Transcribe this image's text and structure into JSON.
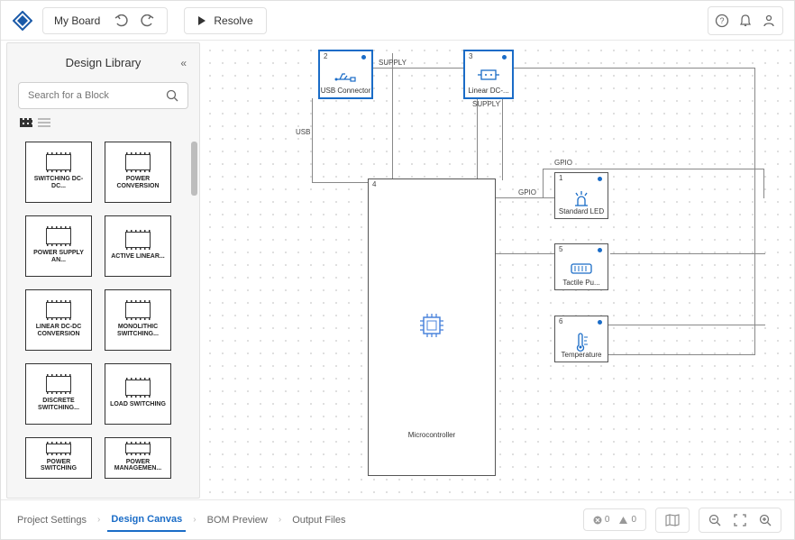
{
  "header": {
    "board_name": "My Board",
    "resolve_label": "Resolve"
  },
  "sidebar": {
    "title": "Design Library",
    "search_placeholder": "Search for a Block",
    "items": [
      {
        "label": "SWITCHING DC-DC..."
      },
      {
        "label": "POWER CONVERSION"
      },
      {
        "label": "POWER SUPPLY AN..."
      },
      {
        "label": "ACTIVE LINEAR..."
      },
      {
        "label": "LINEAR DC-DC CONVERSION"
      },
      {
        "label": "MONOLITHIC SWITCHING..."
      },
      {
        "label": "DISCRETE SWITCHING..."
      },
      {
        "label": "LOAD SWITCHING"
      },
      {
        "label": "POWER SWITCHING"
      },
      {
        "label": "POWER MANAGEMEN..."
      }
    ]
  },
  "canvas": {
    "blocks": {
      "usb": {
        "num": "2",
        "name": "USB Connector"
      },
      "ldo": {
        "num": "3",
        "name": "Linear DC-..."
      },
      "mcu": {
        "num": "4",
        "name": "Microcontroller"
      },
      "led": {
        "num": "1",
        "name": "Standard LED"
      },
      "btn": {
        "num": "5",
        "name": "Tactile Pu..."
      },
      "temp": {
        "num": "6",
        "name": "Temperature"
      }
    },
    "labels": {
      "supply1": "SUPPLY",
      "supply2": "SUPPLY",
      "usb": "USB",
      "gpio1": "GPIO",
      "gpio2": "GPIO"
    }
  },
  "tabs": [
    {
      "label": "Project Settings",
      "active": false
    },
    {
      "label": "Design Canvas",
      "active": true
    },
    {
      "label": "BOM Preview",
      "active": false
    },
    {
      "label": "Output Files",
      "active": false
    }
  ],
  "status": {
    "errors": "0",
    "warnings": "0"
  }
}
